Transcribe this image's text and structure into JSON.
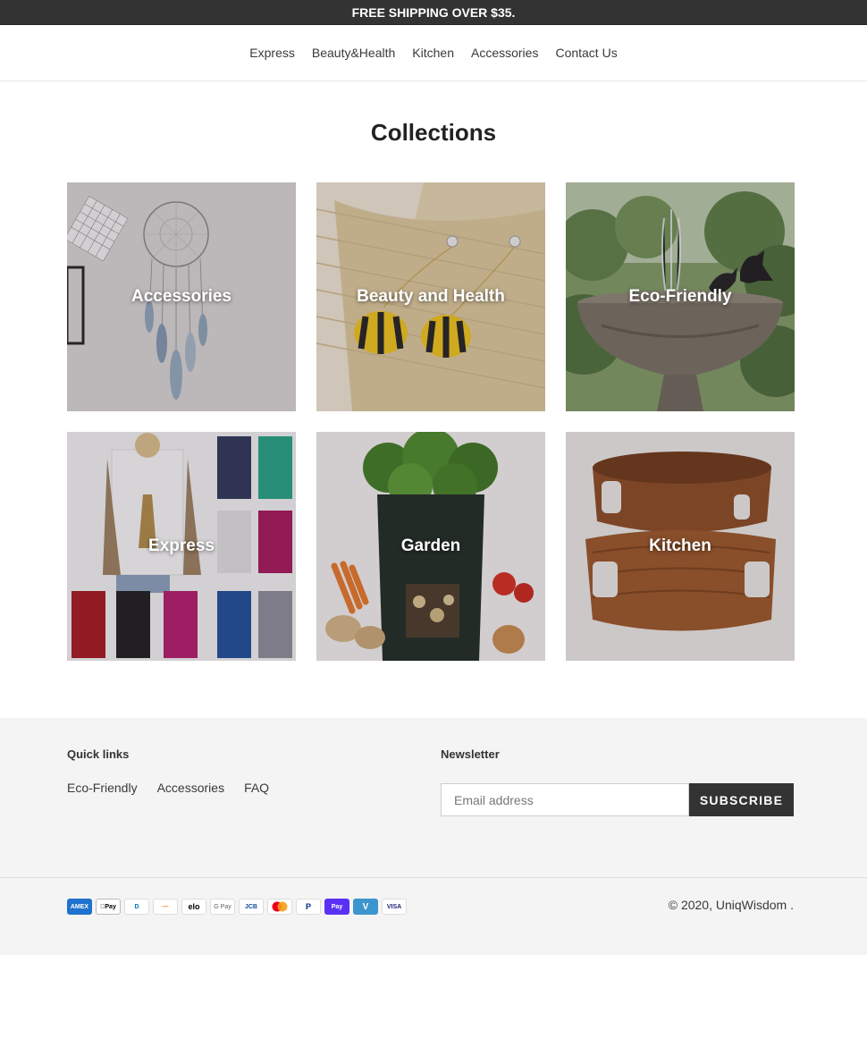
{
  "announcement": "FREE SHIPPING OVER $35.",
  "nav": {
    "items": [
      {
        "label": "Express"
      },
      {
        "label": "Beauty&Health"
      },
      {
        "label": "Kitchen"
      },
      {
        "label": "Accessories"
      },
      {
        "label": "Contact Us"
      }
    ]
  },
  "page_title": "Collections",
  "collections": [
    {
      "label": "Accessories"
    },
    {
      "label": "Beauty and Health"
    },
    {
      "label": "Eco-Friendly"
    },
    {
      "label": "Express"
    },
    {
      "label": "Garden"
    },
    {
      "label": "Kitchen"
    }
  ],
  "footer": {
    "quick_links_title": "Quick links",
    "quick_links": [
      {
        "label": "Eco-Friendly"
      },
      {
        "label": "Accessories"
      },
      {
        "label": "FAQ"
      }
    ],
    "newsletter_title": "Newsletter",
    "email_placeholder": "Email address",
    "subscribe_label": "SUBSCRIBE",
    "payment_icons": [
      {
        "name": "amex",
        "text": "AMEX",
        "bg": "#1f72cd",
        "fg": "#ffffff"
      },
      {
        "name": "apple-pay",
        "text": "Pay",
        "bg": "#ffffff",
        "fg": "#000000"
      },
      {
        "name": "diners-club",
        "text": "D",
        "bg": "#ffffff",
        "fg": "#0079be"
      },
      {
        "name": "discover",
        "text": "—",
        "bg": "#ffffff",
        "fg": "#f48120"
      },
      {
        "name": "elo",
        "text": "elo",
        "bg": "#ffffff",
        "fg": "#000000"
      },
      {
        "name": "google-pay",
        "text": "G Pay",
        "bg": "#ffffff",
        "fg": "#5f6368"
      },
      {
        "name": "jcb",
        "text": "JCB",
        "bg": "#ffffff",
        "fg": "#0e4c96"
      },
      {
        "name": "mastercard",
        "text": "",
        "bg": "#ffffff",
        "fg": "#eb001b"
      },
      {
        "name": "paypal",
        "text": "P",
        "bg": "#ffffff",
        "fg": "#003087"
      },
      {
        "name": "shop-pay",
        "text": "Pay",
        "bg": "#5a31f4",
        "fg": "#ffffff"
      },
      {
        "name": "venmo",
        "text": "V",
        "bg": "#3d95ce",
        "fg": "#ffffff"
      },
      {
        "name": "visa",
        "text": "VISA",
        "bg": "#ffffff",
        "fg": "#1a1f71"
      }
    ],
    "copyright": "© 2020, UniqWisdom ."
  },
  "colors": {
    "announcement_bg": "#333333",
    "footer_bg": "#f4f4f4",
    "button_bg": "#333333"
  }
}
